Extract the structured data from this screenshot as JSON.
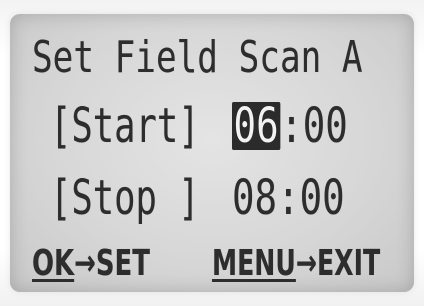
{
  "screen": {
    "title": "Set Field Scan A",
    "start": {
      "label": "[Start]",
      "hour": "06",
      "sep": ":",
      "min": "00"
    },
    "stop": {
      "label": "[Stop ]",
      "hour": "08",
      "sep": ":",
      "min": "00"
    },
    "footer": {
      "ok_key": "OK",
      "ok_action": "→SET",
      "menu_key": "MENU",
      "menu_action": "→EXIT"
    }
  }
}
